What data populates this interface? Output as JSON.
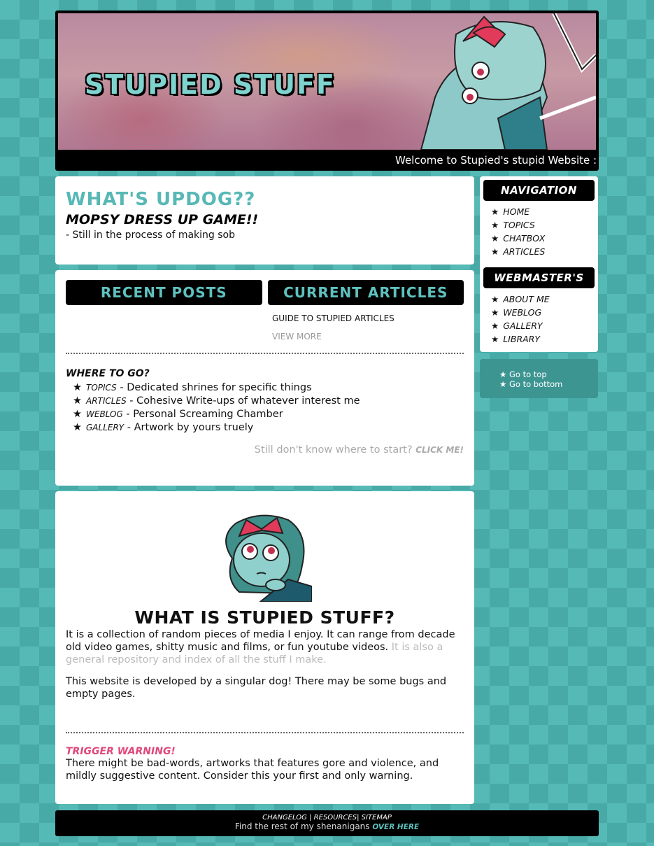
{
  "banner": {
    "title": "STUPIED STUFF",
    "marquee": "Welcome to Stupied's stupid Website :3"
  },
  "updog": {
    "heading": "WHAT'S UPDOG??",
    "subheading": "MOPSY DRESS UP GAME!!",
    "text": "- Still in the process of making sob"
  },
  "posts": {
    "tab_recent": "RECENT POSTS",
    "tab_articles": "CURRENT ARTICLES",
    "article_link": "GUIDE TO STUPIED ARTICLES",
    "view_more": "VIEW MORE",
    "where_heading": "WHERE TO GO?",
    "where_items": [
      {
        "kw": "TOPICS",
        "desc": " - Dedicated shrines for specific things"
      },
      {
        "kw": "ARTICLES",
        "desc": " - Cohesive Write-ups of whatever interest me"
      },
      {
        "kw": "WEBLOG",
        "desc": " - Personal Screaming Chamber"
      },
      {
        "kw": "GALLERY",
        "desc": " - Artwork by yours truely"
      }
    ],
    "hint_text": "Still don't know where to start? ",
    "hint_click": "CLICK ME!"
  },
  "about": {
    "heading": "WHAT IS STUPIED STUFF?",
    "p1": "It is a collection of random pieces of media I enjoy. It can range from decade old video games, shitty music and films, or fun youtube videos. ",
    "p1_muted": "It is also a general repository and index of all the stuff I make.",
    "p2": "This website is developed by a singular dog! There may be some bugs and empty pages.",
    "tw_heading": "TRIGGER WARNING!",
    "tw_text": "There might be bad-words, artworks that features gore and violence, and mildly suggestive content. Consider this your first and only warning."
  },
  "sidebar": {
    "nav_heading": "NAVIGATION",
    "nav_items": [
      "HOME",
      "TOPICS",
      "CHATBOX",
      "ARTICLES"
    ],
    "web_heading": "WEBMASTER'S",
    "web_items": [
      "ABOUT ME",
      "WEBLOG",
      "GALLERY",
      "LIBRARY"
    ],
    "star": "★"
  },
  "goto": {
    "top": "★  Go to top",
    "bottom": "★  Go to bottom"
  },
  "footer": {
    "changelog": "CHANGELOG",
    "sep1": " | ",
    "resources": "RESOURCES",
    "sep2": "| ",
    "sitemap": "SITEMAP",
    "rest": "Find the rest of my shenanigans ",
    "over_here": "OVER HERE"
  },
  "colors": {
    "teal": "#55b9b6",
    "teal_dark": "#3d9592",
    "accent_pink": "#e0487a",
    "heading_teal": "#58b8b5"
  },
  "icons": [
    "star-icon",
    "banner-character-art",
    "mascot-art"
  ]
}
